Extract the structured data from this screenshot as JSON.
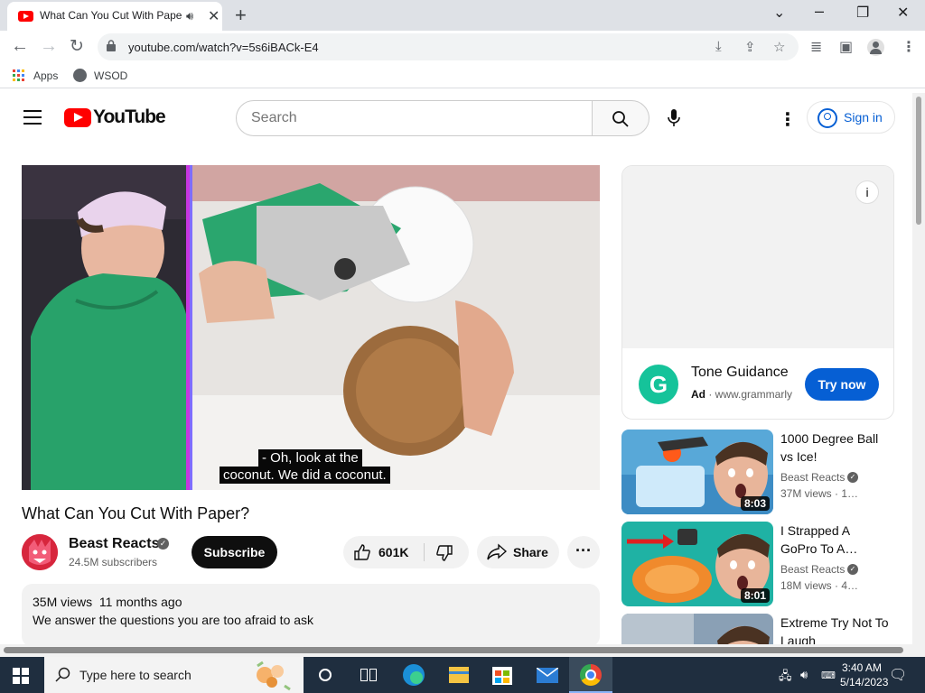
{
  "browser": {
    "tab_title": "What Can You Cut With Paper?",
    "url": "youtube.com/watch?v=5s6iBACk-E4",
    "bookmarks": [
      "Apps",
      "WSOD"
    ]
  },
  "youtube": {
    "logo_text": "YouTube",
    "search_placeholder": "Search",
    "sign_in": "Sign in"
  },
  "video": {
    "captions": [
      "- Oh, look at the",
      "coconut. We did a coconut."
    ],
    "title": "What Can You Cut With Paper?",
    "channel": "Beast Reacts",
    "subscribers": "24.5M subscribers",
    "subscribe": "Subscribe",
    "likes": "601K",
    "share": "Share",
    "views": "35M views",
    "age": "11 months ago",
    "description": "We answer the questions you are too afraid to ask"
  },
  "ad": {
    "title": "Tone Guidance",
    "badge": "Ad",
    "domain": "www.grammarly",
    "cta": "Try now",
    "logo_letter": "G"
  },
  "recommendations": [
    {
      "title": "1000 Degree Ball vs Ice!",
      "channel": "Beast Reacts",
      "views": "37M views · 1…",
      "duration": "8:03"
    },
    {
      "title": "I Strapped A GoPro To A…",
      "channel": "Beast Reacts",
      "views": "18M views · 4…",
      "duration": "8:01"
    },
    {
      "title": "Extreme Try Not To Laugh",
      "channel": "",
      "views": "",
      "duration": ""
    }
  ],
  "taskbar": {
    "search_placeholder": "Type here to search",
    "time": "3:40 AM",
    "date": "5/14/2023"
  }
}
